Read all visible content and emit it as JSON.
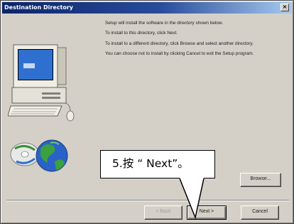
{
  "window": {
    "title": "Destination Directory",
    "close_glyph": "×"
  },
  "body": {
    "paragraphs": [
      "Setup will install the software in the directory shown below.",
      "To install to this directory, click Next.",
      "To install to a different directory, click Browse and select another directory.",
      "You can choose not to install by clicking Cancel to exit the Setup program."
    ]
  },
  "buttons": {
    "browse": "Browse...",
    "back": "< Back",
    "next": "Next >",
    "cancel": "Cancel"
  },
  "callout": {
    "text": "5.按 “ Next”。"
  },
  "colors": {
    "title_bg_start": "#0a246a",
    "title_bg_end": "#a6caf0",
    "window_bg": "#d4d0c8"
  },
  "icons": [
    "computer-icon",
    "globe-icon",
    "disc-icon",
    "close-icon"
  ]
}
